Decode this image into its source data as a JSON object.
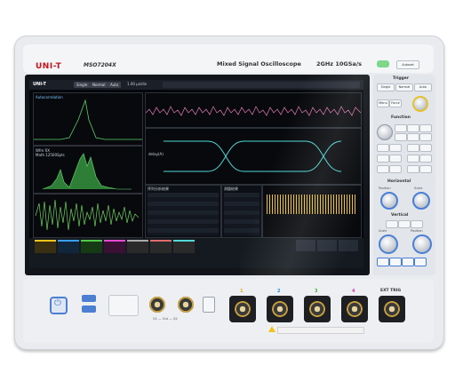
{
  "brand": {
    "logo_text": "UNI-T",
    "model": "MSO7204X",
    "product_name": "Mixed Signal Oscilloscope",
    "spec": "2GHz  10GSa/s"
  },
  "screen": {
    "logo_text": "UNI-T",
    "top_menu": [
      "Single",
      "Normal",
      "Auto"
    ],
    "status_text": "1.00 µs/div",
    "panel_left_top": "Autocorrelation",
    "panel_left_mid_1": "Wfm RX",
    "panel_left_mid_2": "Math 12500Spts",
    "panel_eye_label": "delay(A)",
    "panel_table_title": "序列分析结果",
    "panel_table_title2": "测量结果"
  },
  "right_panel": {
    "trigger_title": "Trigger",
    "trigger_buttons": [
      "Single",
      "Normal",
      "Auto"
    ],
    "menu_buttons": [
      "Menu",
      "Force"
    ],
    "function_title": "Function",
    "horizontal_title": "Horizontal",
    "horizontal_labels": [
      "Position",
      "Scale"
    ],
    "vertical_title": "Vertical",
    "vertical_labels": [
      "Scale",
      "Position"
    ],
    "autoset_label": "Autoset"
  },
  "bottom": {
    "channel_labels": [
      "1",
      "2",
      "3",
      "4"
    ],
    "ext_trig_label": "EXT TRIG",
    "bnc_small_label": "Q1 — Out — Q2",
    "gen_label": "GEN IN"
  },
  "colors": {
    "ch1": "#f0c419",
    "ch2": "#3aa0ff",
    "ch3": "#52c94a",
    "ch4": "#e64bd0",
    "brand_red": "#c8141c"
  }
}
